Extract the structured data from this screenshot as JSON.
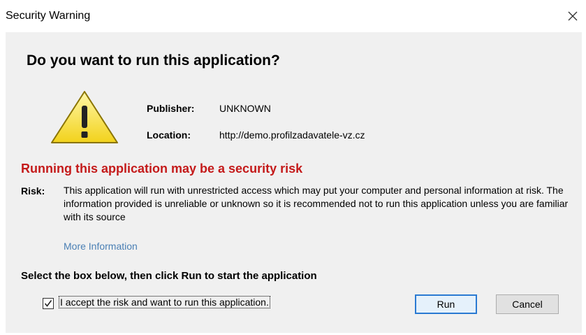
{
  "window": {
    "title": "Security Warning"
  },
  "dialog": {
    "heading": "Do you want to run this application?",
    "publisher": {
      "label": "Publisher:",
      "value": "UNKNOWN"
    },
    "location": {
      "label": "Location:",
      "value": "http://demo.profilzadavatele-vz.cz"
    },
    "risk_heading": "Running this application may be a security risk",
    "risk": {
      "label": "Risk:",
      "text": "This application will run with unrestricted access which may put your computer and personal information at risk. The information provided is unreliable or unknown so it is recommended not to run this application unless you are familiar with its source"
    },
    "more_info": "More Information",
    "instruction": "Select the box below, then click Run to start the application",
    "checkbox": {
      "label": "I accept the risk and want to run this application.",
      "checked": true
    },
    "buttons": {
      "run": "Run",
      "cancel": "Cancel"
    }
  },
  "colors": {
    "warning_red": "#c41a1a",
    "link": "#4a7fb4",
    "panel": "#f0f0f0",
    "focus_border": "#2a7ad2"
  },
  "icons": {
    "close": "close-icon",
    "warning": "warning-triangle-icon",
    "check": "checkmark-icon"
  }
}
